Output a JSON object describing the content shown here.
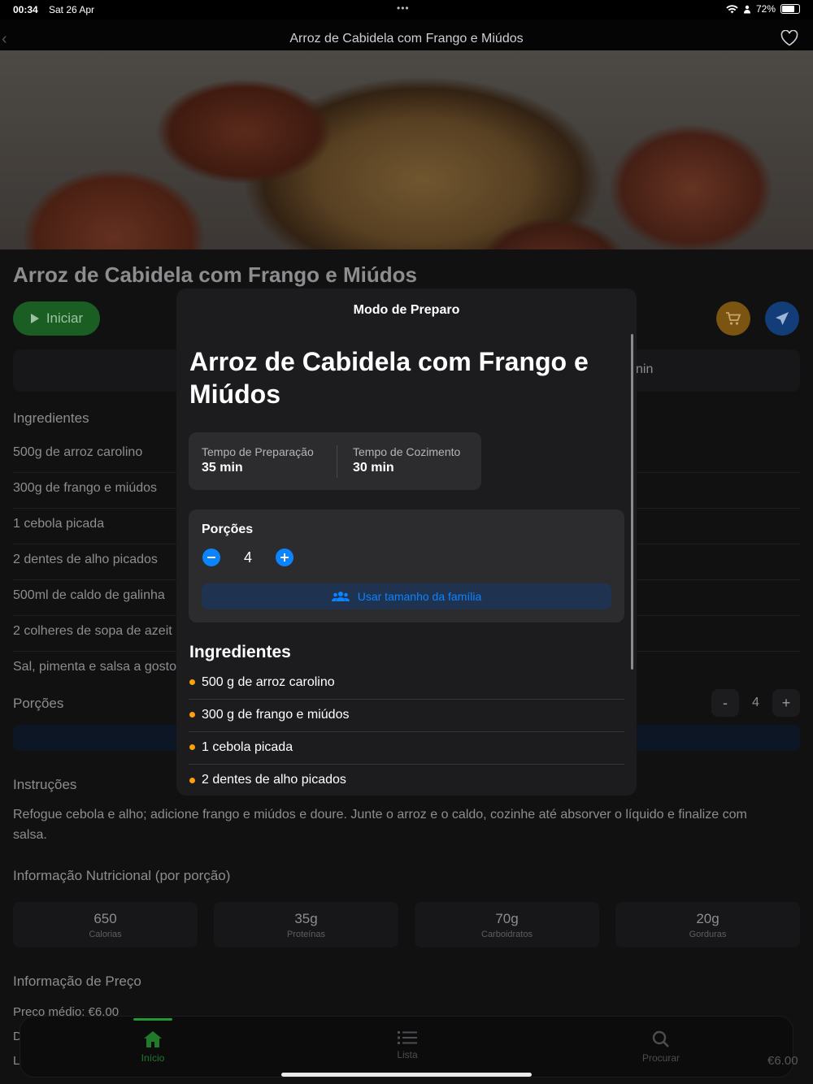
{
  "status": {
    "time": "00:34",
    "date": "Sat 26 Apr",
    "battery": "72%"
  },
  "nav": {
    "title": "Arroz de Cabidela com Frango e Miúdos"
  },
  "page": {
    "title": "Arroz de Cabidela com Frango e Miúdos",
    "start_label": "Iniciar",
    "time_tail": "nin",
    "ingredients_heading": "Ingredientes",
    "ingredients": [
      "500g de arroz carolino",
      "300g de frango e miúdos",
      "1 cebola picada",
      "2 dentes de alho picados",
      "500ml de caldo de galinha",
      "2 colheres de sopa de azeit",
      "Sal, pimenta e salsa a gosto"
    ],
    "portions_label": "Porções",
    "stepper": {
      "minus": "-",
      "value": "4",
      "plus": "+"
    },
    "instructions_heading": "Instruções",
    "instructions": "Refogue cebola e alho; adicione frango e miúdos e doure. Junte o arroz e o caldo, cozinhe até absorver o líquido e finalize com salsa.",
    "nutrition_heading": "Informação Nutricional (por porção)",
    "nutrition": [
      {
        "value": "650",
        "label": "Calorias"
      },
      {
        "value": "35g",
        "label": "Proteínas"
      },
      {
        "value": "70g",
        "label": "Carboidratos"
      },
      {
        "value": "20g",
        "label": "Gorduras"
      }
    ],
    "price_heading": "Informação de Preço",
    "price_avg": "Preço médio: €6.00",
    "cut_line_1": "D",
    "cut_line_2": "Li",
    "price_tail": "€6.00"
  },
  "tabs": [
    {
      "label": "Início",
      "icon": "home-icon",
      "active": true
    },
    {
      "label": "Lista",
      "icon": "list-icon",
      "active": false
    },
    {
      "label": "Procurar",
      "icon": "search-icon",
      "active": false
    }
  ],
  "modal": {
    "title": "Modo de Preparo",
    "recipe_title": "Arroz de Cabidela com Frango e Miúdos",
    "prep_label": "Tempo de Preparação",
    "prep_value": "35 min",
    "cook_label": "Tempo de Cozimento",
    "cook_value": "30 min",
    "portions_label": "Porções",
    "portions_value": "4",
    "family_button": "Usar tamanho da família",
    "ingredients_heading": "Ingredientes",
    "ingredients": [
      "500 g de arroz carolino",
      "300 g de frango e miúdos",
      "1 cebola picada",
      "2 dentes de alho picados"
    ]
  },
  "colors": {
    "accent_blue": "#0a84ff",
    "accent_orange": "#ff9f0a",
    "accent_green": "#1f9a34"
  }
}
